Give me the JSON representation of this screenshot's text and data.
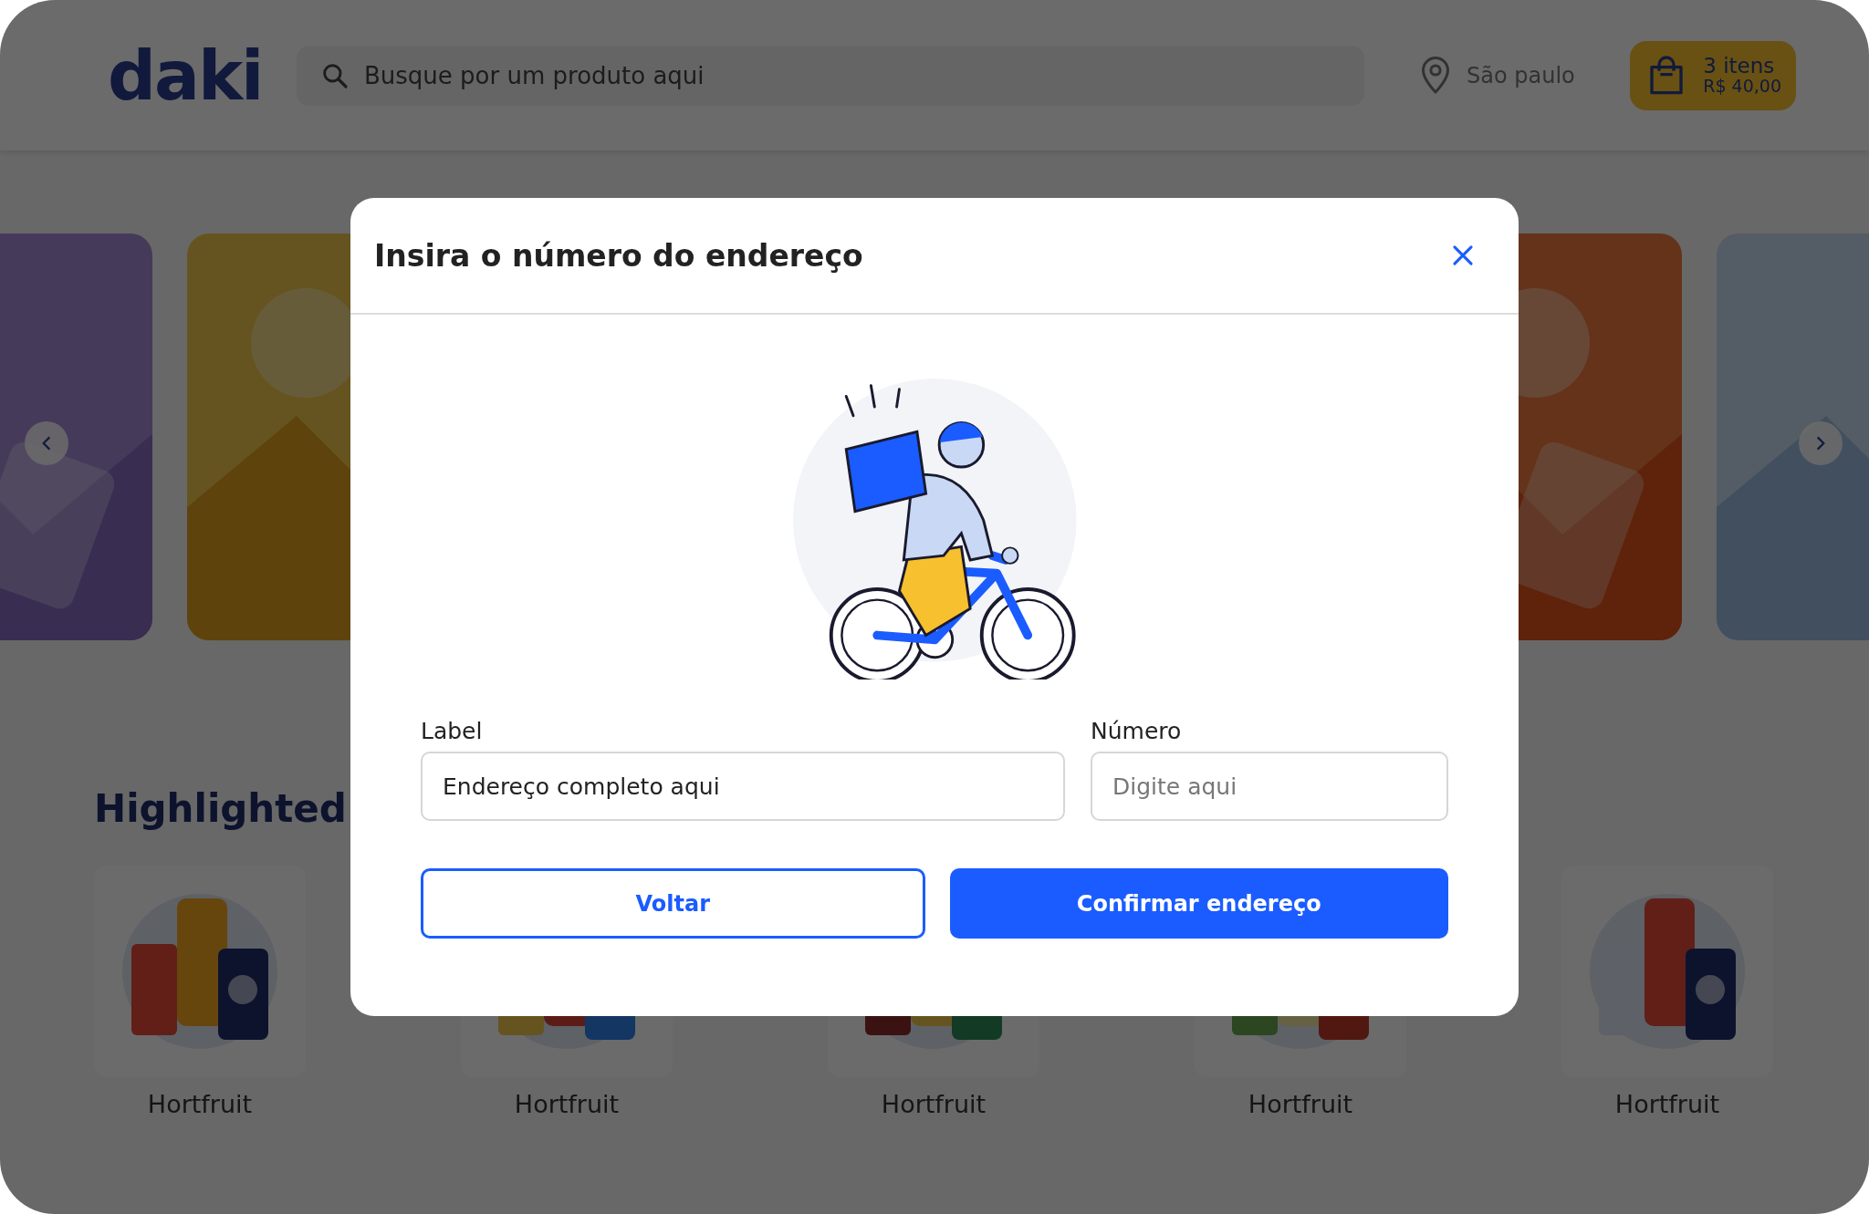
{
  "header": {
    "logo": "daki",
    "search": {
      "placeholder": "Busque por um produto aqui"
    },
    "location": "São paulo",
    "cart": {
      "count": "3 itens",
      "total": "R$ 40,00"
    }
  },
  "section": {
    "title": "Highlighted",
    "products": [
      {
        "name": "Hortfruit"
      },
      {
        "name": "Hortfruit"
      },
      {
        "name": "Hortfruit"
      },
      {
        "name": "Hortfruit"
      },
      {
        "name": "Hortfruit"
      }
    ]
  },
  "modal": {
    "title": "Insira o número do endereço",
    "fields": [
      {
        "label": "Label",
        "value": "Endereço completo aqui"
      },
      {
        "label": "Número",
        "placeholder": "Digite aqui"
      }
    ],
    "buttons": [
      {
        "label": "Voltar",
        "kind": "secondary"
      },
      {
        "label": "Confirmar endereço",
        "kind": "primary"
      }
    ]
  }
}
